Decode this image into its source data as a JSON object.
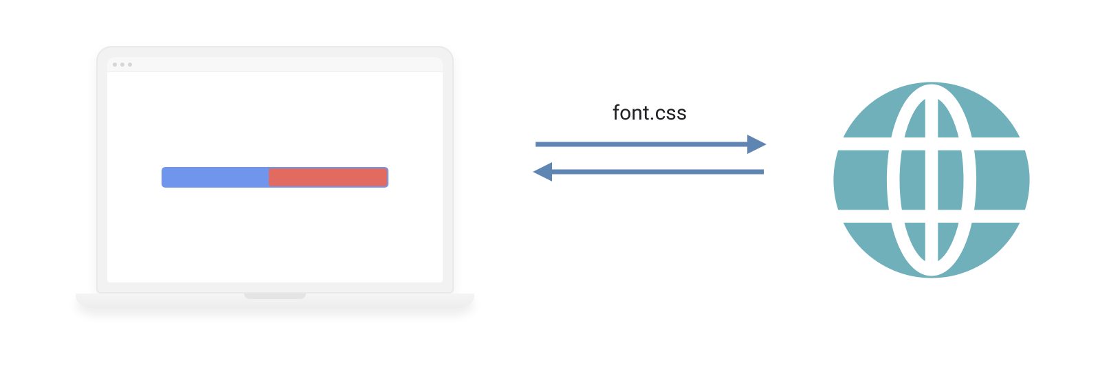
{
  "diagram": {
    "label": "font.css",
    "arrow_color": "#5f86b3",
    "globe_color": "#70b0bb",
    "progress": {
      "blue_color": "#6f95ec",
      "red_color": "#e16b61",
      "red_percent": 52
    }
  }
}
